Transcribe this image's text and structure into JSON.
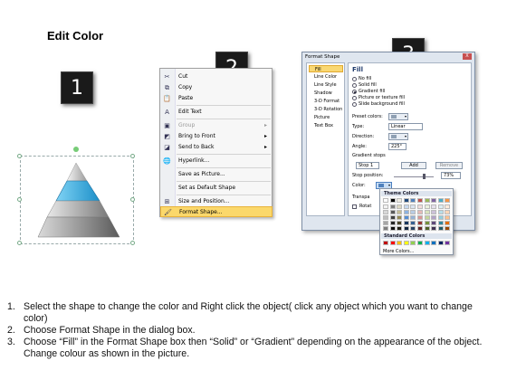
{
  "page": {
    "title": "Edit Color"
  },
  "badges": [
    "1",
    "2",
    "3"
  ],
  "context_menu": {
    "items": [
      {
        "label": "Cut",
        "icon": "scissors-icon",
        "disabled": false,
        "submenu": false,
        "highlight": false
      },
      {
        "label": "Copy",
        "icon": "copy-icon",
        "disabled": false,
        "submenu": false,
        "highlight": false
      },
      {
        "label": "Paste",
        "icon": "paste-icon",
        "disabled": false,
        "submenu": false,
        "highlight": false
      },
      {
        "label": "Edit Text",
        "icon": "edit-text-icon",
        "disabled": false,
        "submenu": false,
        "highlight": false
      },
      {
        "label": "Group",
        "icon": "group-icon",
        "disabled": true,
        "submenu": true,
        "highlight": false
      },
      {
        "label": "Bring to Front",
        "icon": "bring-front-icon",
        "disabled": false,
        "submenu": true,
        "highlight": false
      },
      {
        "label": "Send to Back",
        "icon": "send-back-icon",
        "disabled": false,
        "submenu": true,
        "highlight": false
      },
      {
        "label": "Hyperlink...",
        "icon": "hyperlink-icon",
        "disabled": false,
        "submenu": false,
        "highlight": false
      },
      {
        "label": "Save as Picture...",
        "icon": "",
        "disabled": false,
        "submenu": false,
        "highlight": false
      },
      {
        "label": "Set as Default Shape",
        "icon": "",
        "disabled": false,
        "submenu": false,
        "highlight": false
      },
      {
        "label": "Size and Position...",
        "icon": "size-icon",
        "disabled": false,
        "submenu": false,
        "highlight": false
      },
      {
        "label": "Format Shape...",
        "icon": "format-shape-icon",
        "disabled": false,
        "submenu": false,
        "highlight": true
      }
    ]
  },
  "dialog": {
    "title": "Format Shape",
    "close_label": "X",
    "categories": [
      "Fill",
      "Line Color",
      "Line Style",
      "Shadow",
      "3-D Format",
      "3-D Rotation",
      "Picture",
      "Text Box"
    ],
    "selected_category": "Fill",
    "fill_heading": "Fill",
    "fill_options": [
      "No fill",
      "Solid fill",
      "Gradient fill",
      "Picture or texture fill",
      "Slide background fill"
    ],
    "selected_fill": "Gradient fill",
    "preset_colors_label": "Preset colors:",
    "type_label": "Type:",
    "type_value": "Linear",
    "direction_label": "Direction:",
    "angle_label": "Angle:",
    "angle_value": "225°",
    "gradient_stops_label": "Gradient stops",
    "stop_value": "Stop 1",
    "add_label": "Add",
    "remove_label": "Remove",
    "stop_position_label": "Stop position:",
    "stop_position_value": "73%",
    "color_label": "Color:",
    "transparency_label": "Transpa",
    "rotate_label": "Rotat"
  },
  "palette": {
    "theme_label": "Theme Colors",
    "standard_label": "Standard Colors",
    "more_label": "More Colors...",
    "theme_top": [
      "#ffffff",
      "#000000",
      "#eeece1",
      "#1f497d",
      "#4f81bd",
      "#c0504d",
      "#9bbb59",
      "#8064a2",
      "#4bacc6",
      "#f79646"
    ],
    "theme_shades": [
      [
        "#f2f2f2",
        "#7f7f7f",
        "#ddd9c3",
        "#c6d9f0",
        "#dbe5f1",
        "#f2dcdb",
        "#ebf1dd",
        "#e5e0ec",
        "#dbeef3",
        "#fdeada"
      ],
      [
        "#d8d8d8",
        "#595959",
        "#c4bd97",
        "#8db3e2",
        "#b8cce4",
        "#e5b9b7",
        "#d7e3bc",
        "#ccc1d9",
        "#b7dde8",
        "#fbd5b5"
      ],
      [
        "#bfbfbf",
        "#3f3f3f",
        "#938953",
        "#548dd4",
        "#95b3d7",
        "#d99694",
        "#c3d69b",
        "#b2a2c7",
        "#92cddc",
        "#fac08f"
      ],
      [
        "#a5a5a5",
        "#262626",
        "#494429",
        "#17365d",
        "#366092",
        "#953734",
        "#76923c",
        "#5f497a",
        "#31859b",
        "#e36c09"
      ],
      [
        "#7f7f7f",
        "#0c0c0c",
        "#1d1b10",
        "#0f243e",
        "#244061",
        "#632423",
        "#4f6128",
        "#3f3151",
        "#205867",
        "#974806"
      ]
    ],
    "standard": [
      "#c00000",
      "#ff0000",
      "#ffc000",
      "#ffff00",
      "#92d050",
      "#00b050",
      "#00b0f0",
      "#0070c0",
      "#002060",
      "#7030a0"
    ]
  },
  "instructions": [
    {
      "num": "1.",
      "text": "Select the shape to change the color and Right click the object( click any object which you want to change color)"
    },
    {
      "num": "2.",
      "text": "Choose Format Shape in the dialog box."
    },
    {
      "num": "3.",
      "text": "Choose “Fill” in the Format Shape box then “Solid” or “Gradient” depending on the appearance of the object. Change colour as shown in the picture."
    }
  ]
}
